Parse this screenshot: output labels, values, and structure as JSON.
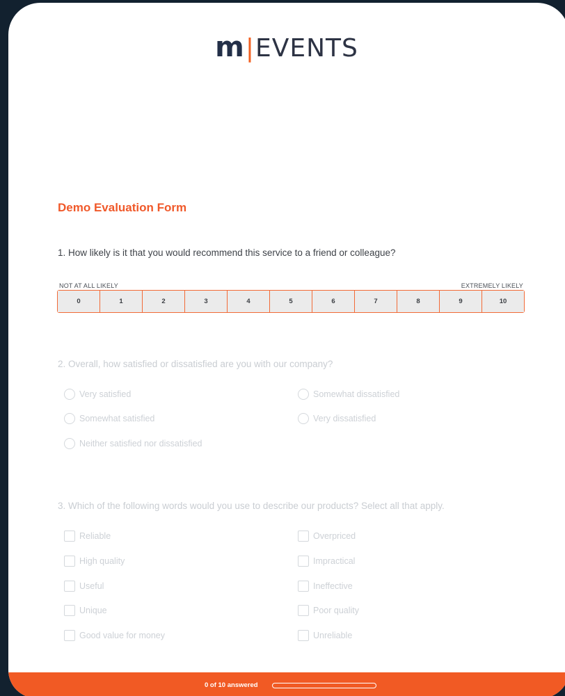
{
  "logo": {
    "m": "m",
    "bar": "|",
    "events": "EVENTS"
  },
  "form": {
    "title": "Demo Evaluation Form"
  },
  "q1": {
    "text": "1. How likely is it that you would recommend this service to a friend or colleague?",
    "left_label": "NOT AT ALL LIKELY",
    "right_label": "EXTREMELY LIKELY",
    "scale": [
      "0",
      "1",
      "2",
      "3",
      "4",
      "5",
      "6",
      "7",
      "8",
      "9",
      "10"
    ]
  },
  "q2": {
    "text": "2. Overall, how satisfied or dissatisfied are you with our company?",
    "options": [
      "Very satisfied",
      "Somewhat dissatisfied",
      "Somewhat satisfied",
      "Very dissatisfied",
      "Neither satisfied nor dissatisfied"
    ]
  },
  "q3": {
    "text": "3. Which of the following words would you use to describe our products? Select all that apply.",
    "options": [
      "Reliable",
      "Overpriced",
      "High quality",
      "Impractical",
      "Useful",
      "Ineffective",
      "Unique",
      "Poor quality",
      "Good value for money",
      "Unreliable"
    ]
  },
  "footer": {
    "progress_text": "0 of 10 answered",
    "progress_fraction": 0
  },
  "colors": {
    "accent": "#f15a24",
    "background": "#12212f",
    "brand_navy": "#232f48"
  }
}
